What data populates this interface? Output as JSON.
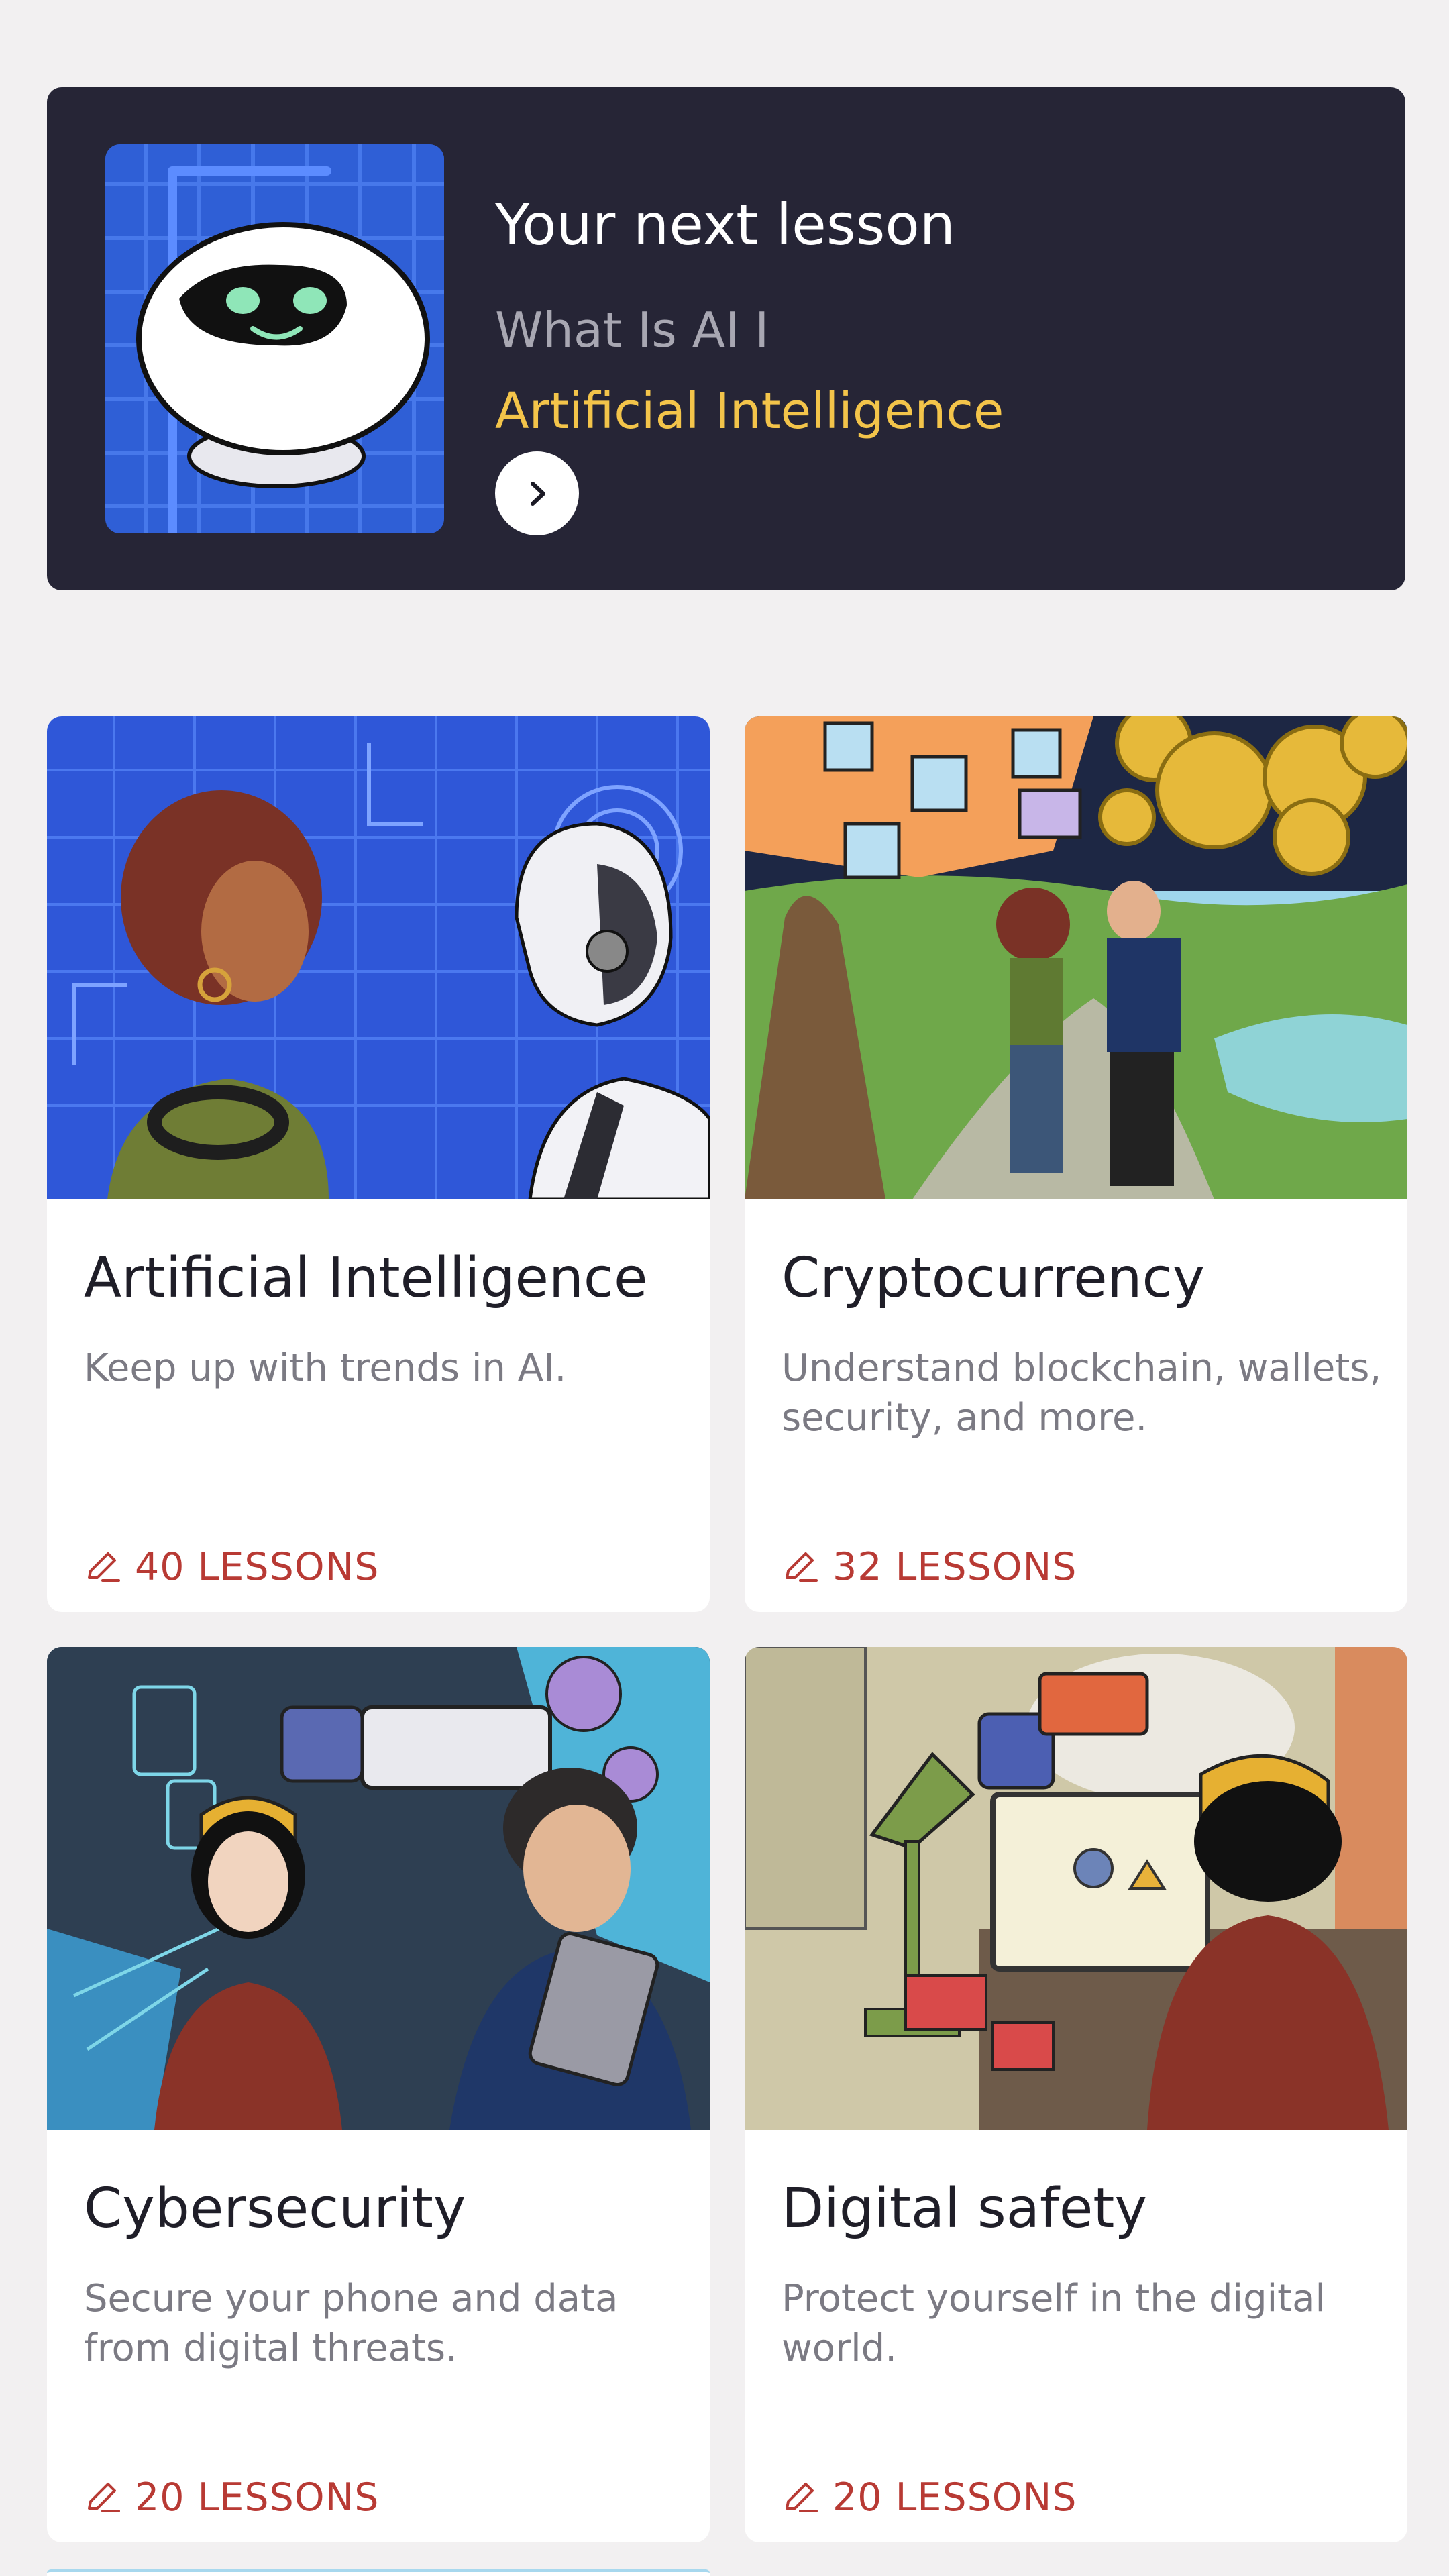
{
  "next_lesson": {
    "heading": "Your next lesson",
    "lesson_name": "What Is AI I",
    "course_name": "Artificial Intelligence"
  },
  "courses": [
    {
      "title": "Artificial Intelligence",
      "description": "Keep up with trends in AI.",
      "lessons": "40 LESSONS"
    },
    {
      "title": "Cryptocurrency",
      "description": "Understand blockchain, wallets, security, and more.",
      "lessons": "32 LESSONS"
    },
    {
      "title": "Cybersecurity",
      "description": "Secure your phone and data from digital threats.",
      "lessons": "20 LESSONS"
    },
    {
      "title": "Digital safety",
      "description": "Protect yourself in the digital world.",
      "lessons": "20 LESSONS"
    }
  ],
  "colors": {
    "page_bg": "#f2f0f1",
    "next_card_bg": "#262536",
    "accent_yellow": "#f3c44a",
    "lessons_red": "#b83a34"
  },
  "icons": [
    "robot-illustration",
    "chevron-right-icon",
    "pencil-icon"
  ]
}
